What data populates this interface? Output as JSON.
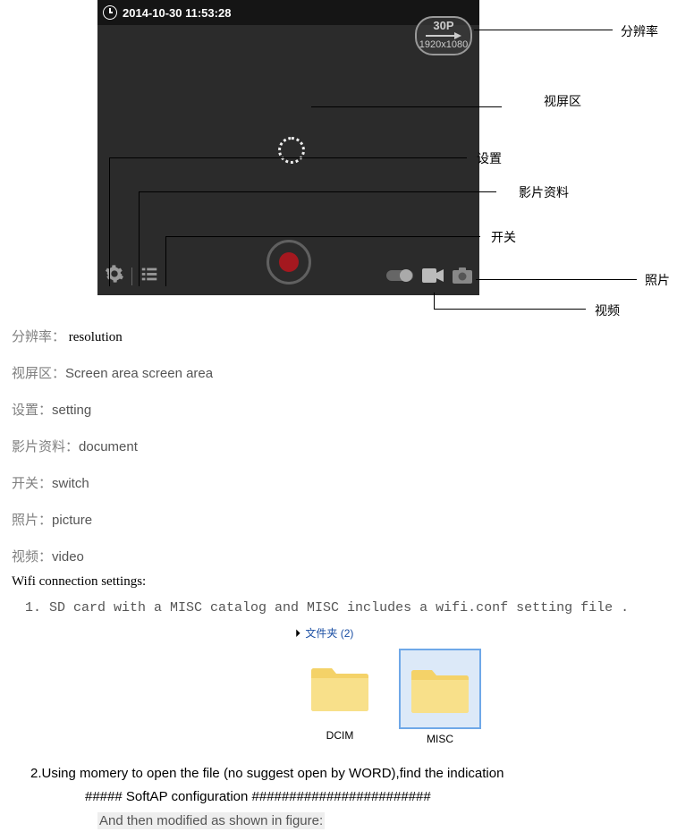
{
  "camera": {
    "timestamp": "2014-10-30 11:53:28",
    "res_line1": "30P",
    "res_line2": "1920x1080"
  },
  "annotations": {
    "resolution": "分辨率",
    "screen_area": "视屏区",
    "settings": "设置",
    "film_info": "影片资料",
    "switch": "开关",
    "photo": "照片",
    "video": "视频"
  },
  "definitions": [
    {
      "cn": "分辨率：",
      "en": " resolution"
    },
    {
      "cn": "视屏区：",
      "en": "Screen area screen area"
    },
    {
      "cn": "设置：",
      "en": "setting"
    },
    {
      "cn": "影片资料：",
      "en": "document"
    },
    {
      "cn": "开关：",
      "en": "switch"
    },
    {
      "cn": "照片：",
      "en": "picture"
    },
    {
      "cn": "视频：",
      "en": "video"
    }
  ],
  "wifi": {
    "title": "Wifi connection settings:",
    "step1": "1. SD card with a MISC catalog and MISC includes a wifi.conf setting file .",
    "folder_crumb": "文件夹 (2)",
    "folder_dcim": "DCIM",
    "folder_misc": "MISC",
    "step2": "2.Using momery to open the file (no suggest open by WORD),find the indication",
    "config_line": "##### SoftAP configuration ########################",
    "modified": "And then modified as shown in figure:"
  }
}
